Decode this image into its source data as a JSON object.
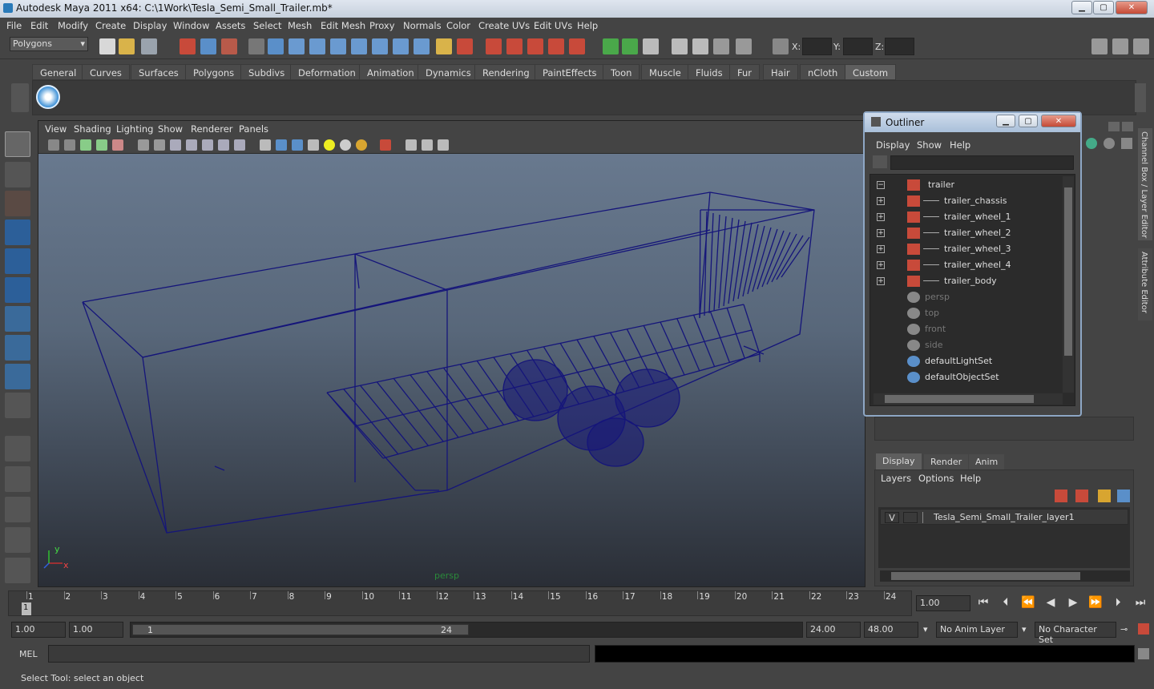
{
  "window": {
    "title": "Autodesk Maya 2011 x64: C:\\1Work\\Tesla_Semi_Small_Trailer.mb*",
    "min": "▁",
    "max": "▢",
    "close": "✕"
  },
  "menus": [
    "File",
    "Edit",
    "Modify",
    "Create",
    "Display",
    "Window",
    "Assets",
    "Select",
    "Mesh",
    "Edit Mesh",
    "Proxy",
    "Normals",
    "Color",
    "Create UVs",
    "Edit UVs",
    "Help"
  ],
  "toolbar": {
    "mode": "Polygons",
    "x_label": "X:",
    "y_label": "Y:",
    "z_label": "Z:"
  },
  "shelf_tabs": [
    "General",
    "Curves",
    "Surfaces",
    "Polygons",
    "Subdivs",
    "Deformation",
    "Animation",
    "Dynamics",
    "Rendering",
    "PaintEffects",
    "Toon",
    "Muscle",
    "Fluids",
    "Fur",
    "Hair",
    "nCloth",
    "Custom"
  ],
  "shelf_active": "Custom",
  "viewport": {
    "menus": [
      "View",
      "Shading",
      "Lighting",
      "Show",
      "Renderer",
      "Panels"
    ],
    "camera_label": "persp",
    "axis_x": "x",
    "axis_y": "y"
  },
  "outliner": {
    "title": "Outliner",
    "menus": [
      "Display",
      "Show",
      "Help"
    ],
    "items": [
      {
        "label": "trailer",
        "kind": "group",
        "expander": "−",
        "dim": false
      },
      {
        "label": "trailer_chassis",
        "kind": "mesh",
        "expander": "+",
        "dim": false
      },
      {
        "label": "trailer_wheel_1",
        "kind": "mesh",
        "expander": "+",
        "dim": false
      },
      {
        "label": "trailer_wheel_2",
        "kind": "mesh",
        "expander": "+",
        "dim": false
      },
      {
        "label": "trailer_wheel_3",
        "kind": "mesh",
        "expander": "+",
        "dim": false
      },
      {
        "label": "trailer_wheel_4",
        "kind": "mesh",
        "expander": "+",
        "dim": false
      },
      {
        "label": "trailer_body",
        "kind": "mesh",
        "expander": "+",
        "dim": false
      },
      {
        "label": "persp",
        "kind": "camera",
        "expander": "",
        "dim": true
      },
      {
        "label": "top",
        "kind": "camera",
        "expander": "",
        "dim": true
      },
      {
        "label": "front",
        "kind": "camera",
        "expander": "",
        "dim": true
      },
      {
        "label": "side",
        "kind": "camera",
        "expander": "",
        "dim": true
      },
      {
        "label": "defaultLightSet",
        "kind": "set",
        "expander": "",
        "dim": false
      },
      {
        "label": "defaultObjectSet",
        "kind": "set",
        "expander": "",
        "dim": false
      }
    ]
  },
  "layer_editor": {
    "tabs": [
      "Display",
      "Render",
      "Anim"
    ],
    "menus": [
      "Layers",
      "Options",
      "Help"
    ],
    "layer": {
      "visible": "V",
      "name": "Tesla_Semi_Small_Trailer_layer1"
    }
  },
  "side_tabs": [
    "Channel Box / Layer Editor",
    "Attribute Editor"
  ],
  "timeline": {
    "ticks": [
      "1",
      "2",
      "3",
      "4",
      "5",
      "6",
      "7",
      "8",
      "9",
      "10",
      "11",
      "12",
      "13",
      "14",
      "15",
      "16",
      "17",
      "18",
      "19",
      "20",
      "21",
      "22",
      "23",
      "24"
    ],
    "current": "1",
    "current_time": "1.00"
  },
  "range": {
    "start": "1.00",
    "playback_start": "1.00",
    "slider_start": "1",
    "slider_end": "24",
    "playback_end": "24.00",
    "end": "48.00",
    "anim_layer": "No Anim Layer",
    "character_set": "No Character Set"
  },
  "command": {
    "label": "MEL"
  },
  "help_line": "Select Tool: select an object",
  "colors": {
    "wireframe": "#15157a",
    "viewport_top": "#6b7c92",
    "viewport_bottom": "#2a2e36",
    "panel": "#444444"
  }
}
